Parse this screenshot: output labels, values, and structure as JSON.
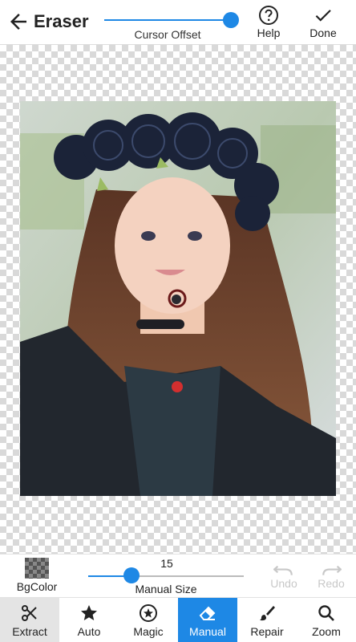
{
  "header": {
    "title": "Eraser",
    "cursor_offset_label": "Cursor Offset",
    "help_label": "Help",
    "done_label": "Done",
    "cursor_offset_value": 0.92
  },
  "canvas": {
    "photo_description_icon": "portrait-image"
  },
  "controls": {
    "bgcolor_label": "BgColor",
    "manual_size_value": "15",
    "manual_size_label": "Manual Size",
    "undo_label": "Undo",
    "redo_label": "Redo",
    "manual_size_fraction": 0.28
  },
  "nav": {
    "items": [
      {
        "label": "Extract",
        "icon": "scissors-icon"
      },
      {
        "label": "Auto",
        "icon": "star-icon"
      },
      {
        "label": "Magic",
        "icon": "magic-star-icon"
      },
      {
        "label": "Manual",
        "icon": "eraser-icon"
      },
      {
        "label": "Repair",
        "icon": "brush-icon"
      },
      {
        "label": "Zoom",
        "icon": "magnifier-icon"
      }
    ],
    "active": "Manual"
  },
  "colors": {
    "accent": "#1e88e5",
    "cursor_marker": "#d32f2f"
  }
}
